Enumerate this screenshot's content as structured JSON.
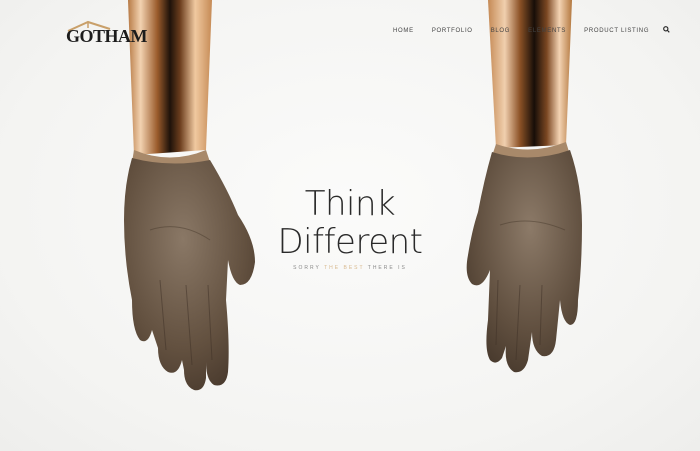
{
  "brand": {
    "logo_text": "GOTHAM",
    "accent_color": "#c9a06a"
  },
  "nav": {
    "items": [
      "HOME",
      "PORTFOLIO",
      "BLOG",
      "ELEMENTS",
      "PRODUCT LISTING"
    ],
    "search_icon": "search-icon"
  },
  "hero": {
    "title_line1": "Think",
    "title_line2": "Different",
    "tagline_prefix": "SORRY",
    "tagline_accent": "THE BEST",
    "tagline_suffix": "THERE IS"
  }
}
